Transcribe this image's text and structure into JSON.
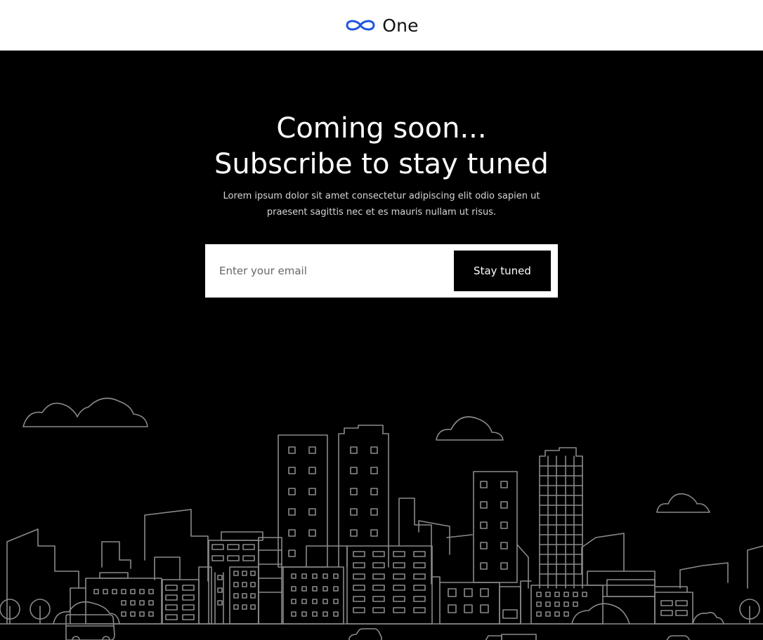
{
  "brand": {
    "name": "One",
    "accent_color": "#1f56e0",
    "icon": "infinity-icon"
  },
  "hero": {
    "title_line1": "Coming soon...",
    "title_line2": "Subscribe to stay tuned",
    "subtitle_line1": "Lorem ipsum dolor sit amet consectetur adipiscing elit odio sapien ut",
    "subtitle_line2": "praesent sagittis nec et es mauris nullam ut risus."
  },
  "signup": {
    "email_placeholder": "Enter your email",
    "email_value": "",
    "button_label": "Stay tuned"
  },
  "colors": {
    "background": "#000000",
    "header_bg": "#ffffff",
    "illustration_stroke": "#8a8a8a"
  }
}
